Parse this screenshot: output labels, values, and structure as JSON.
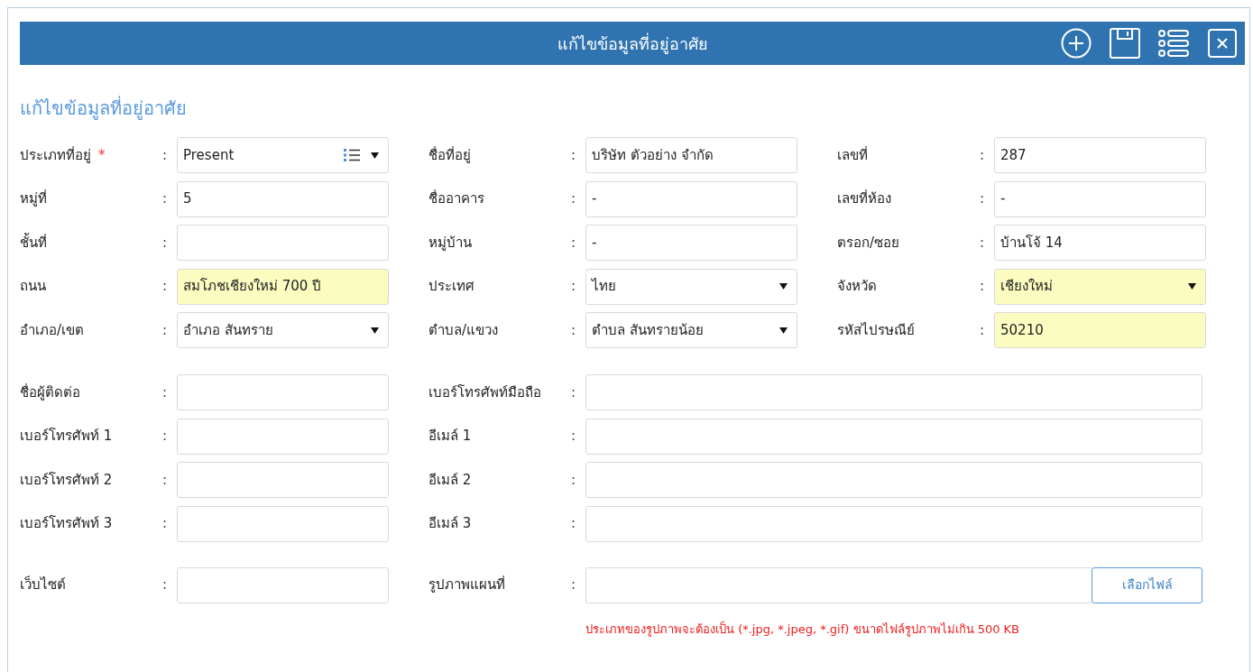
{
  "header": {
    "title": "แก้ไขข้อมูลที่อยู่อาศัย"
  },
  "section_title": "แก้ไขข้อมูลที่อยู่อาศัย",
  "address_rows": [
    [
      {
        "label": "ประเภทที่อยู่",
        "required_mark": "*",
        "colon": ":",
        "kind": "list-select",
        "value": "Present",
        "highlighted": false
      },
      {
        "label": "ชื่อที่อยู่",
        "colon": ":",
        "kind": "text",
        "value": "บริษัท ตัวอย่าง จำกัด",
        "highlighted": false
      },
      {
        "label": "เลขที่",
        "colon": ":",
        "kind": "text",
        "value": "287",
        "highlighted": false
      }
    ],
    [
      {
        "label": "หมู่ที่",
        "colon": ":",
        "kind": "text",
        "value": "5",
        "highlighted": false
      },
      {
        "label": "ชื่ออาคาร",
        "colon": ":",
        "kind": "text",
        "value": "-",
        "highlighted": false
      },
      {
        "label": "เลขที่ห้อง",
        "colon": ":",
        "kind": "text",
        "value": "-",
        "highlighted": false
      }
    ],
    [
      {
        "label": "ชั้นที่",
        "colon": ":",
        "kind": "text",
        "highlighted": false
      },
      {
        "label": "หมู่บ้าน",
        "colon": ":",
        "kind": "text",
        "value": "-",
        "highlighted": false
      },
      {
        "label": "ตรอก/ซอย",
        "colon": ":",
        "kind": "text",
        "value": "บ้านโจ้ 14",
        "highlighted": false
      }
    ],
    [
      {
        "label": "ถนน",
        "colon": ":",
        "kind": "text",
        "value": "สมโภชเชียงใหม่ 700 ปี",
        "highlighted": true
      },
      {
        "label": "ประเทศ",
        "colon": ":",
        "kind": "select",
        "value": "ไทย",
        "highlighted": false
      },
      {
        "label": "จังหวัด",
        "colon": ":",
        "kind": "select",
        "value": "เชียงใหม่",
        "highlighted": true
      }
    ],
    [
      {
        "label": "อำเภอ/เขต",
        "colon": ":",
        "kind": "select",
        "value": "อำเภอ สันทราย",
        "highlighted": false
      },
      {
        "label": "ตำบล/แขวง",
        "colon": ":",
        "kind": "select",
        "value": "ตำบล สันทรายน้อย",
        "highlighted": false
      },
      {
        "label": "รหัสไปรษณีย์",
        "colon": ":",
        "kind": "text",
        "value": "50210",
        "highlighted": true
      }
    ]
  ],
  "contact_rows": [
    [
      {
        "label": "ชื่อผู้ติดต่อ",
        "colon": ":"
      },
      {
        "label": "เบอร์โทรศัพท์มือถือ",
        "colon": ":"
      }
    ],
    [
      {
        "label": "เบอร์โทรศัพท์ 1",
        "colon": ":"
      },
      {
        "label": "อีเมล์ 1",
        "colon": ":"
      }
    ],
    [
      {
        "label": "เบอร์โทรศัพท์ 2",
        "colon": ":"
      },
      {
        "label": "อีเมล์ 2",
        "colon": ":"
      }
    ],
    [
      {
        "label": "เบอร์โทรศัพท์ 3",
        "colon": ":"
      },
      {
        "label": "อีเมล์ 3",
        "colon": ":"
      }
    ]
  ],
  "website": {
    "label": "เว็บไซต์",
    "colon": ":"
  },
  "map_image": {
    "label": "รูปภาพแผนที่",
    "colon": ":",
    "button": "เลือกไฟล์",
    "hint": "ประเภทของรูปภาพจะต้องเป็น (*.jpg, *.jpeg, *.gif) ขนาดไฟล์รูปภาพไม่เกิน 500 KB"
  }
}
